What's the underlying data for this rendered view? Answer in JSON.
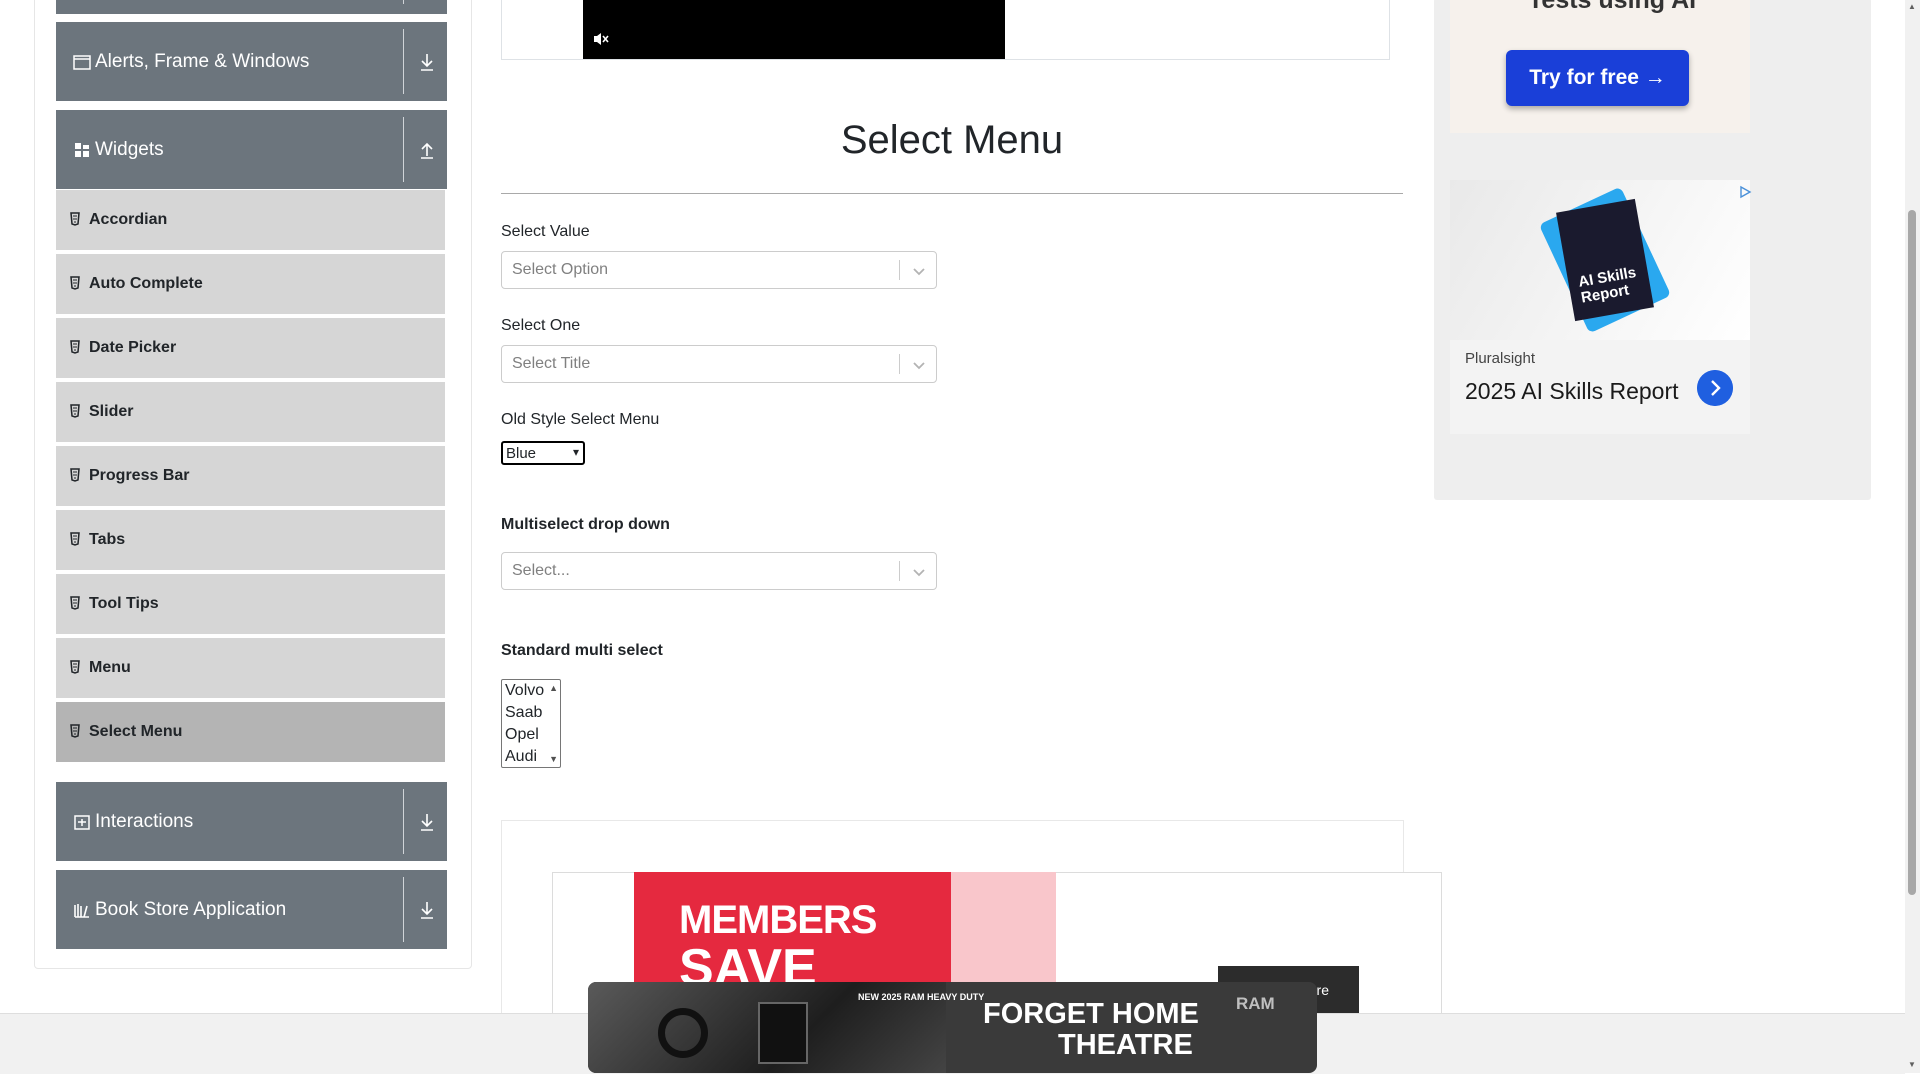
{
  "sidebar": {
    "groups": [
      {
        "label": "Alerts, Frame & Windows",
        "arrow": "download-arrow"
      },
      {
        "label": "Widgets",
        "arrow": "upload-arrow"
      },
      {
        "label": "Interactions",
        "arrow": "download-arrow"
      },
      {
        "label": "Book Store Application",
        "arrow": "download-arrow"
      }
    ],
    "widget_items": [
      {
        "label": "Accordian"
      },
      {
        "label": "Auto Complete"
      },
      {
        "label": "Date Picker"
      },
      {
        "label": "Slider"
      },
      {
        "label": "Progress Bar"
      },
      {
        "label": "Tabs"
      },
      {
        "label": "Tool Tips"
      },
      {
        "label": "Menu"
      },
      {
        "label": "Select Menu",
        "active": true
      }
    ]
  },
  "main": {
    "title": "Select Menu",
    "select_value": {
      "label": "Select Value",
      "placeholder": "Select Option"
    },
    "select_one": {
      "label": "Select One",
      "placeholder": "Select Title"
    },
    "old_style": {
      "label": "Old Style Select Menu",
      "selected": "Blue"
    },
    "multiselect": {
      "label": "Multiselect drop down",
      "placeholder": "Select..."
    },
    "standard_multi": {
      "label": "Standard multi select",
      "options": [
        "Volvo",
        "Saab",
        "Opel",
        "Audi"
      ]
    }
  },
  "ads": {
    "right": {
      "top_text": "Tests using AI",
      "cta": "Try for free →",
      "book_text": "AI Skills Report",
      "publisher": "Pluralsight",
      "headline": "2025 AI Skills Report"
    },
    "members": {
      "line1": "MEMBERS",
      "line2": "SAVE"
    },
    "dark_button_text": "re",
    "sticky": {
      "tagline": "NEW 2025 RAM HEAVY DUTY",
      "slogan_line1": "FORGET HOME",
      "slogan_line2": "THEATRE",
      "brand": "RAM"
    }
  },
  "colors": {
    "sidebar_header": "#6c757d",
    "sidebar_item": "#d6d6d6",
    "sidebar_item_active": "#b4b4b4",
    "cta_blue": "#1a3fd8",
    "members_red": "#e5293f"
  }
}
